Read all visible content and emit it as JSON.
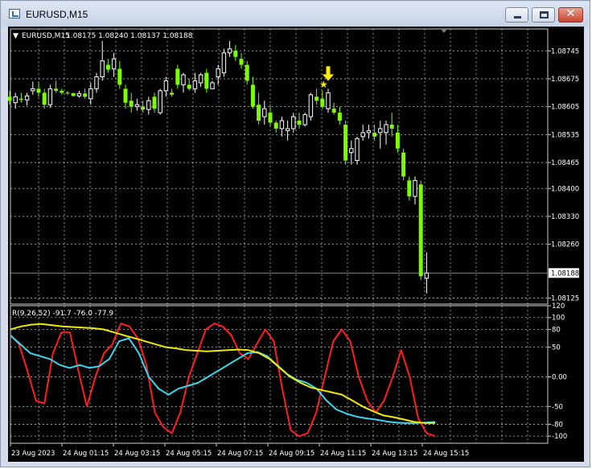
{
  "window": {
    "title": "EURUSD,M15",
    "minimize_icon": "minimize-icon",
    "maximize_icon": "maximize-icon",
    "close_icon": "close-icon"
  },
  "chart_header": {
    "symbol": "EURUSD,M15",
    "ohlc": "1.08175 1.08240 1.08137 1.08188"
  },
  "price_axis": {
    "labels": [
      "1.08745",
      "1.08675",
      "1.08605",
      "1.08535",
      "1.08465",
      "1.08400",
      "1.08330",
      "1.08260",
      "1.08188",
      "1.08125"
    ],
    "current_price": "1.08188"
  },
  "indicator": {
    "label": "R(9,26,52) -91.7 -76.0 -77.9",
    "axis_labels": [
      "120",
      "100",
      "80",
      "50",
      "0.00",
      "-50",
      "-80",
      "-100"
    ]
  },
  "time_axis": {
    "labels": [
      "23 Aug 2023",
      "24 Aug 01:15",
      "24 Aug 03:15",
      "24 Aug 05:15",
      "24 Aug 07:15",
      "24 Aug 09:15",
      "24 Aug 11:15",
      "24 Aug 13:15",
      "24 Aug 15:15"
    ]
  },
  "colors": {
    "background": "#000000",
    "bull": "#ffffff",
    "bear": "#7cfc00",
    "grid": "#b8b8b8",
    "signal": "#ffee00",
    "fast_line": "#ff1f1f",
    "mid_line": "#3cd8f0",
    "slow_line": "#f2ea00"
  },
  "chart_data": [
    {
      "type": "candlestick",
      "title": "EURUSD,M15",
      "ylim": [
        1.0811,
        1.088
      ],
      "candles": [
        {
          "o": 1.0863,
          "h": 1.08645,
          "l": 1.0861,
          "c": 1.0862
        },
        {
          "o": 1.08615,
          "h": 1.0864,
          "l": 1.086,
          "c": 1.0863
        },
        {
          "o": 1.08625,
          "h": 1.0864,
          "l": 1.08615,
          "c": 1.08622
        },
        {
          "o": 1.08622,
          "h": 1.0864,
          "l": 1.08608,
          "c": 1.08632
        },
        {
          "o": 1.08645,
          "h": 1.08668,
          "l": 1.08635,
          "c": 1.0865
        },
        {
          "o": 1.0865,
          "h": 1.08668,
          "l": 1.0863,
          "c": 1.0864
        },
        {
          "o": 1.0864,
          "h": 1.0865,
          "l": 1.086,
          "c": 1.0861
        },
        {
          "o": 1.0861,
          "h": 1.0866,
          "l": 1.08602,
          "c": 1.0865
        },
        {
          "o": 1.0865,
          "h": 1.0867,
          "l": 1.0864,
          "c": 1.08645
        },
        {
          "o": 1.08645,
          "h": 1.0865,
          "l": 1.08635,
          "c": 1.0864
        },
        {
          "o": 1.0864,
          "h": 1.08645,
          "l": 1.08635,
          "c": 1.08639
        },
        {
          "o": 1.08639,
          "h": 1.0864,
          "l": 1.0863,
          "c": 1.08632
        },
        {
          "o": 1.08632,
          "h": 1.08645,
          "l": 1.08628,
          "c": 1.08638
        },
        {
          "o": 1.08638,
          "h": 1.0865,
          "l": 1.08625,
          "c": 1.0863
        },
        {
          "o": 1.08625,
          "h": 1.08665,
          "l": 1.0861,
          "c": 1.0865
        },
        {
          "o": 1.0865,
          "h": 1.0869,
          "l": 1.0864,
          "c": 1.0868
        },
        {
          "o": 1.0868,
          "h": 1.0877,
          "l": 1.0867,
          "c": 1.0872
        },
        {
          "o": 1.0871,
          "h": 1.08725,
          "l": 1.0869,
          "c": 1.08698
        },
        {
          "o": 1.087,
          "h": 1.0874,
          "l": 1.0868,
          "c": 1.08725
        },
        {
          "o": 1.087,
          "h": 1.0872,
          "l": 1.0865,
          "c": 1.0866
        },
        {
          "o": 1.0865,
          "h": 1.0866,
          "l": 1.086,
          "c": 1.08615
        },
        {
          "o": 1.0862,
          "h": 1.0864,
          "l": 1.0859,
          "c": 1.08605
        },
        {
          "o": 1.08605,
          "h": 1.08625,
          "l": 1.08595,
          "c": 1.0861
        },
        {
          "o": 1.08605,
          "h": 1.0862,
          "l": 1.0859,
          "c": 1.08598
        },
        {
          "o": 1.08598,
          "h": 1.0863,
          "l": 1.08585,
          "c": 1.0862
        },
        {
          "o": 1.0863,
          "h": 1.0864,
          "l": 1.0859,
          "c": 1.086
        },
        {
          "o": 1.0859,
          "h": 1.0865,
          "l": 1.08585,
          "c": 1.08645
        },
        {
          "o": 1.08645,
          "h": 1.0868,
          "l": 1.0863,
          "c": 1.0867
        },
        {
          "o": 1.0864,
          "h": 1.0865,
          "l": 1.0863,
          "c": 1.08635
        },
        {
          "o": 1.087,
          "h": 1.0871,
          "l": 1.0865,
          "c": 1.0866
        },
        {
          "o": 1.0866,
          "h": 1.0869,
          "l": 1.0864,
          "c": 1.08685
        },
        {
          "o": 1.0866,
          "h": 1.08675,
          "l": 1.08645,
          "c": 1.0865
        },
        {
          "o": 1.0865,
          "h": 1.0869,
          "l": 1.0864,
          "c": 1.0867
        },
        {
          "o": 1.08665,
          "h": 1.0869,
          "l": 1.08655,
          "c": 1.08685
        },
        {
          "o": 1.0869,
          "h": 1.087,
          "l": 1.0864,
          "c": 1.0865
        },
        {
          "o": 1.0865,
          "h": 1.0867,
          "l": 1.0865,
          "c": 1.08665
        },
        {
          "o": 1.0868,
          "h": 1.0871,
          "l": 1.0866,
          "c": 1.087
        },
        {
          "o": 1.0869,
          "h": 1.0875,
          "l": 1.0868,
          "c": 1.0874
        },
        {
          "o": 1.0874,
          "h": 1.0877,
          "l": 1.0873,
          "c": 1.0875
        },
        {
          "o": 1.08745,
          "h": 1.0876,
          "l": 1.0872,
          "c": 1.0873
        },
        {
          "o": 1.08725,
          "h": 1.0874,
          "l": 1.087,
          "c": 1.0871
        },
        {
          "o": 1.0871,
          "h": 1.0872,
          "l": 1.0866,
          "c": 1.0867
        },
        {
          "o": 1.0866,
          "h": 1.0868,
          "l": 1.086,
          "c": 1.08605
        },
        {
          "o": 1.0861,
          "h": 1.0864,
          "l": 1.0856,
          "c": 1.0857
        },
        {
          "o": 1.0858,
          "h": 1.0862,
          "l": 1.0856,
          "c": 1.086
        },
        {
          "o": 1.0859,
          "h": 1.0861,
          "l": 1.08555,
          "c": 1.08565
        },
        {
          "o": 1.08565,
          "h": 1.0857,
          "l": 1.0854,
          "c": 1.0855
        },
        {
          "o": 1.0855,
          "h": 1.0858,
          "l": 1.0853,
          "c": 1.0857
        },
        {
          "o": 1.08545,
          "h": 1.0857,
          "l": 1.0852,
          "c": 1.0855
        },
        {
          "o": 1.0855,
          "h": 1.0859,
          "l": 1.0854,
          "c": 1.0858
        },
        {
          "o": 1.0857,
          "h": 1.0859,
          "l": 1.0855,
          "c": 1.0856
        },
        {
          "o": 1.0856,
          "h": 1.0859,
          "l": 1.08555,
          "c": 1.08585
        },
        {
          "o": 1.0858,
          "h": 1.0864,
          "l": 1.0857,
          "c": 1.08635
        },
        {
          "o": 1.0863,
          "h": 1.0865,
          "l": 1.0861,
          "c": 1.0862
        },
        {
          "o": 1.08625,
          "h": 1.08645,
          "l": 1.086,
          "c": 1.08605
        },
        {
          "o": 1.086,
          "h": 1.0865,
          "l": 1.0859,
          "c": 1.0864
        },
        {
          "o": 1.086,
          "h": 1.08615,
          "l": 1.08585,
          "c": 1.0859
        },
        {
          "o": 1.0859,
          "h": 1.08605,
          "l": 1.0856,
          "c": 1.0857
        },
        {
          "o": 1.0856,
          "h": 1.0857,
          "l": 1.0846,
          "c": 1.0847
        },
        {
          "o": 1.0849,
          "h": 1.0852,
          "l": 1.0846,
          "c": 1.085
        },
        {
          "o": 1.0847,
          "h": 1.0853,
          "l": 1.0846,
          "c": 1.08525
        },
        {
          "o": 1.0853,
          "h": 1.0856,
          "l": 1.0852,
          "c": 1.0854
        },
        {
          "o": 1.0854,
          "h": 1.0856,
          "l": 1.08525,
          "c": 1.08545
        },
        {
          "o": 1.0854,
          "h": 1.0856,
          "l": 1.0852,
          "c": 1.0853
        },
        {
          "o": 1.0854,
          "h": 1.0857,
          "l": 1.085,
          "c": 1.0855
        },
        {
          "o": 1.0854,
          "h": 1.0857,
          "l": 1.0851,
          "c": 1.0856
        },
        {
          "o": 1.0856,
          "h": 1.0859,
          "l": 1.0853,
          "c": 1.0855
        },
        {
          "o": 1.0854,
          "h": 1.0856,
          "l": 1.0849,
          "c": 1.085
        },
        {
          "o": 1.0849,
          "h": 1.085,
          "l": 1.0842,
          "c": 1.0843
        },
        {
          "o": 1.0842,
          "h": 1.0843,
          "l": 1.0837,
          "c": 1.0838
        },
        {
          "o": 1.0838,
          "h": 1.0843,
          "l": 1.0836,
          "c": 1.0842
        },
        {
          "o": 1.0841,
          "h": 1.0842,
          "l": 1.0817,
          "c": 1.0818
        },
        {
          "o": 1.08175,
          "h": 1.0824,
          "l": 1.08137,
          "c": 1.08188
        }
      ],
      "current_price": 1.08188,
      "signals": [
        "arrow-down",
        "star"
      ]
    },
    {
      "type": "line",
      "title": "R(9,26,52)",
      "ylim": [
        -112,
        120
      ],
      "reference_lines": [
        -100,
        -80,
        -50,
        0,
        50,
        80,
        100
      ],
      "series": [
        {
          "name": "fast",
          "color": "#ff1f1f",
          "values": [
            70,
            55,
            10,
            -40,
            -45,
            40,
            75,
            75,
            10,
            -50,
            0,
            40,
            55,
            90,
            85,
            65,
            20,
            -60,
            -85,
            -95,
            -60,
            0,
            40,
            80,
            90,
            85,
            70,
            40,
            30,
            55,
            80,
            60,
            -20,
            -90,
            -100,
            -95,
            -60,
            0,
            60,
            80,
            60,
            0,
            -40,
            -60,
            -40,
            0,
            45,
            0,
            -70,
            -95,
            -100
          ]
        },
        {
          "name": "mid",
          "color": "#3cd8f0",
          "values": [
            70,
            55,
            40,
            35,
            30,
            20,
            15,
            20,
            15,
            18,
            30,
            60,
            65,
            40,
            0,
            -20,
            -30,
            -20,
            -15,
            -10,
            0,
            10,
            20,
            30,
            40,
            42,
            35,
            20,
            5,
            -5,
            -10,
            -20,
            -40,
            -55,
            -62,
            -67,
            -70,
            -72,
            -75,
            -77,
            -78,
            -78,
            -77,
            -76
          ]
        },
        {
          "name": "slow",
          "color": "#f2ea00",
          "values": [
            80,
            85,
            88,
            89,
            87,
            85,
            84,
            83,
            82,
            80,
            75,
            70,
            65,
            60,
            55,
            50,
            48,
            45,
            44,
            43,
            44,
            45,
            46,
            45,
            40,
            30,
            15,
            0,
            -10,
            -18,
            -22,
            -26,
            -30,
            -40,
            -50,
            -58,
            -65,
            -68,
            -72,
            -76,
            -78,
            -78
          ]
        }
      ]
    }
  ]
}
